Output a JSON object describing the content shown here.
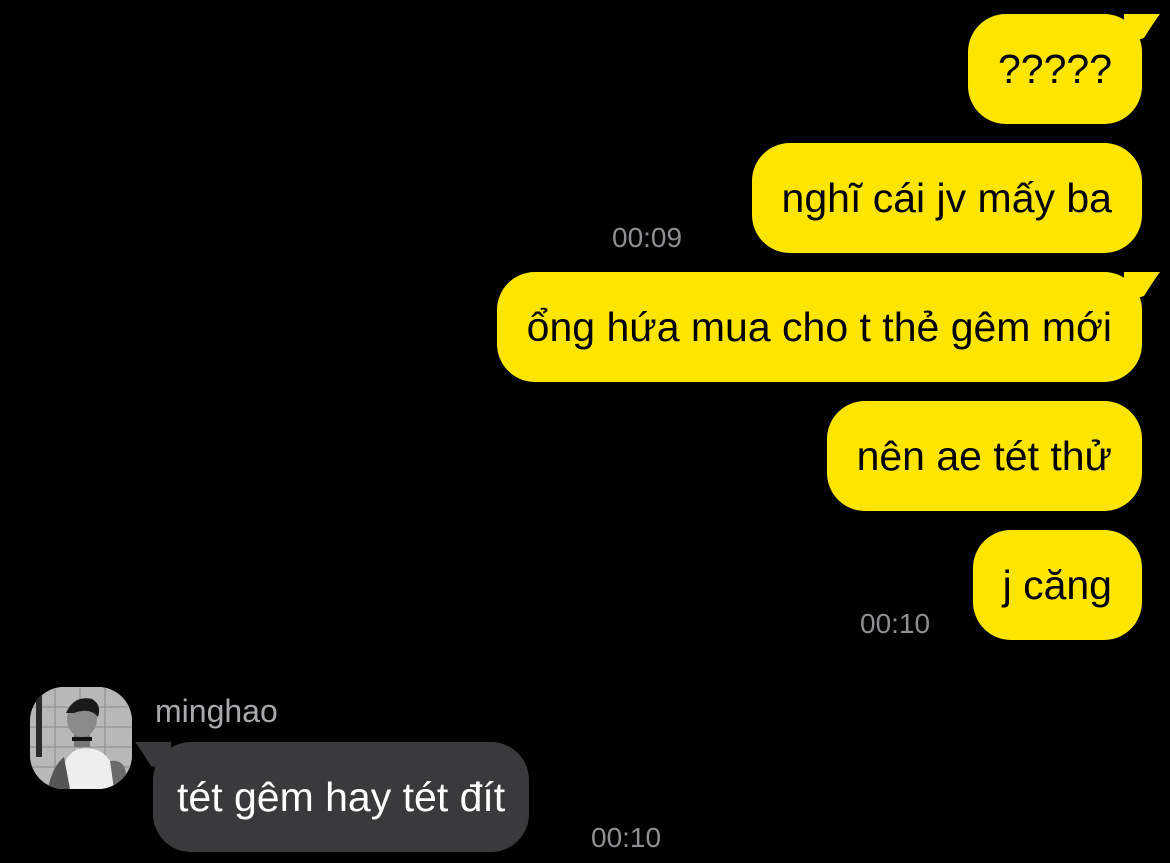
{
  "chat": {
    "outgoing": [
      {
        "text": "?????"
      },
      {
        "text": "nghĩ cái jv mấy ba",
        "time": "00:09"
      },
      {
        "text": "ổng hứa mua cho t thẻ gêm mới"
      },
      {
        "text": "nên ae tét thử"
      },
      {
        "text": "j căng",
        "time": "00:10"
      }
    ],
    "incoming": [
      {
        "sender": "minghao",
        "text": "tét gêm hay tét đít",
        "time": "00:10"
      }
    ]
  },
  "colors": {
    "background": "#000000",
    "outgoing_bubble": "#FEE500",
    "incoming_bubble": "#3A3A3C",
    "timestamp": "#8E8E93"
  },
  "icons": {
    "avatar": "profile-photo"
  }
}
